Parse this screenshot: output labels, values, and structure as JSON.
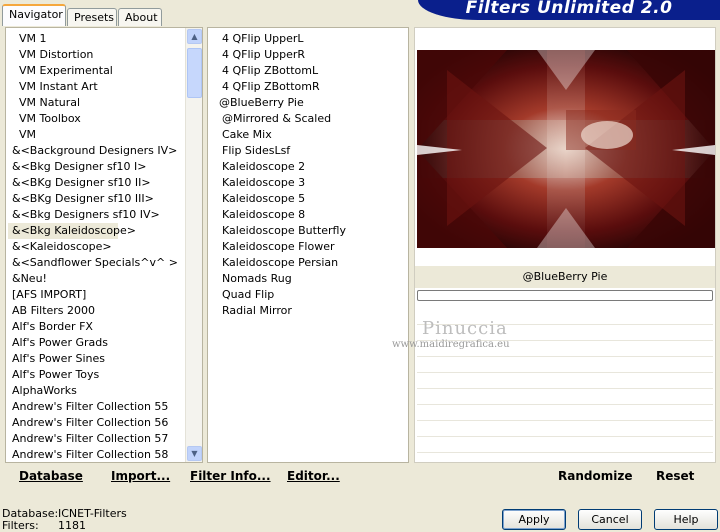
{
  "tabs": [
    "Navigator",
    "Presets",
    "About"
  ],
  "brand_title": "Filters Unlimited 2.0",
  "categories": [
    "VM 1",
    "VM Distortion",
    "VM Experimental",
    "VM Instant Art",
    "VM Natural",
    "VM Toolbox",
    "VM",
    "&<Background Designers IV>",
    "&<Bkg Designer sf10 I>",
    "&<BKg Designer sf10 II>",
    "&<BKg Designer sf10 III>",
    "&<Bkg Designers sf10 IV>",
    "&<Bkg Kaleidoscope>",
    "&<Kaleidoscope>",
    "&<Sandflower Specials^v^ >",
    "&Neu!",
    "[AFS IMPORT]",
    "AB Filters 2000",
    "Alf's Border FX",
    "Alf's Power Grads",
    "Alf's Power Sines",
    "Alf's Power Toys",
    "AlphaWorks",
    "Andrew's Filter Collection 55",
    "Andrew's Filter Collection 56",
    "Andrew's Filter Collection 57",
    "Andrew's Filter Collection 58"
  ],
  "selected_category": "&<Bkg Kaleidoscope>",
  "filters": [
    "4 QFlip UpperL",
    "4 QFlip UpperR",
    "4 QFlip ZBottomL",
    "4 QFlip ZBottomR",
    "@BlueBerry Pie",
    "@Mirrored & Scaled",
    "Cake Mix",
    "Flip SidesLsf",
    "Kaleidoscope 2",
    "Kaleidoscope 3",
    "Kaleidoscope 5",
    "Kaleidoscope 8",
    "Kaleidoscope Butterfly",
    "Kaleidoscope Flower",
    "Kaleidoscope Persian",
    "Nomads Rug",
    "Quad Flip",
    "Radial Mirror"
  ],
  "selected_filter": "@BlueBerry Pie",
  "preview_label": "@BlueBerry Pie",
  "watermark": {
    "name": "Pinuccia",
    "url": "www.maidiregrafica.eu"
  },
  "toolbar": {
    "database": "Database",
    "import": "Import...",
    "filter_info": "Filter Info...",
    "editor": "Editor...",
    "randomize": "Randomize",
    "reset": "Reset"
  },
  "status": {
    "database_label": "Database:",
    "database_value": "ICNET-Filters",
    "filters_label": "Filters:",
    "filters_value": "1181"
  },
  "buttons": {
    "apply": "Apply",
    "cancel": "Cancel",
    "help": "Help"
  },
  "colors": {
    "brand_blue": "#0a1f8c",
    "selection_blue": "#316ac5",
    "tab_accent": "#f5a73c"
  }
}
